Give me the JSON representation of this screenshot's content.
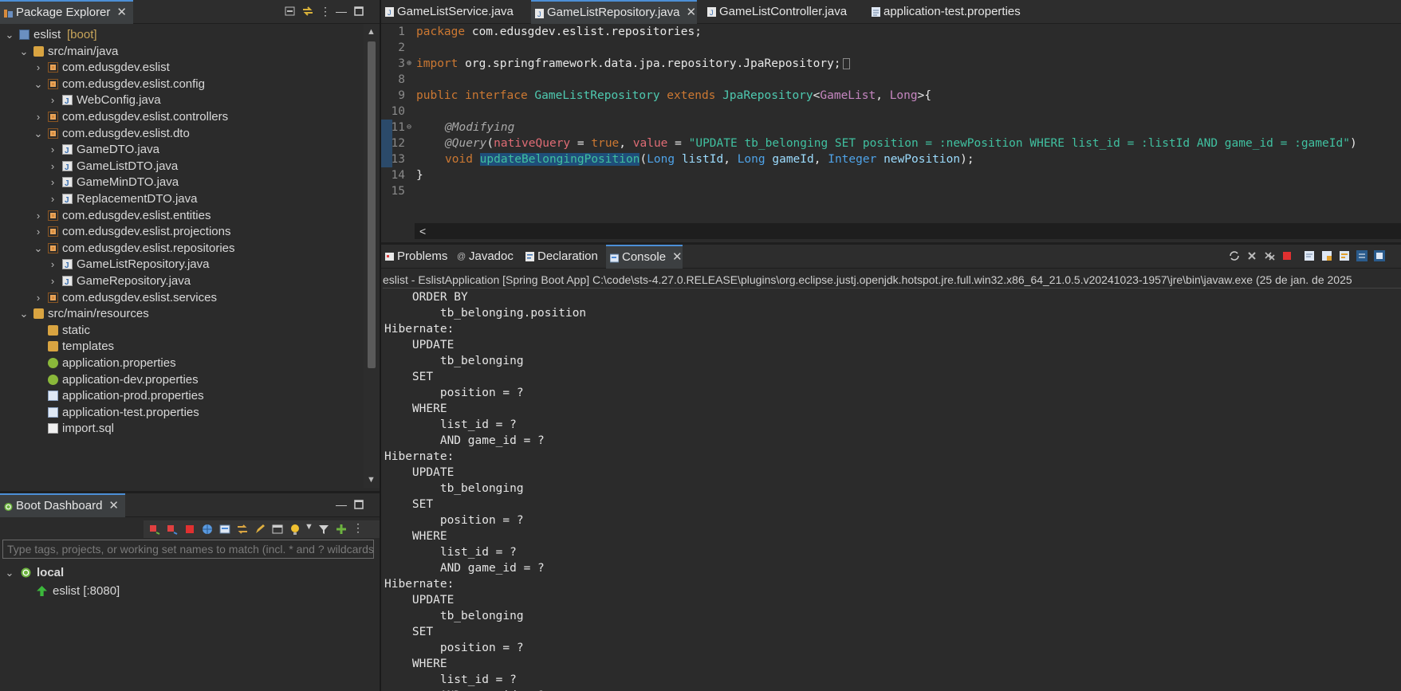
{
  "package_explorer": {
    "title": "Package Explorer",
    "tree": [
      {
        "label": "eslist",
        "decor": " [boot]",
        "icon": "project-icon",
        "level": 0,
        "expanded": true
      },
      {
        "label": "src/main/java",
        "icon": "source-folder-icon",
        "level": 1,
        "expanded": true
      },
      {
        "label": "com.edusgdev.eslist",
        "icon": "package-icon",
        "level": 2,
        "expanded": false
      },
      {
        "label": "com.edusgdev.eslist.config",
        "icon": "package-icon",
        "level": 2,
        "expanded": true
      },
      {
        "label": "WebConfig.java",
        "icon": "java-file-icon",
        "level": 3,
        "expanded": false
      },
      {
        "label": "com.edusgdev.eslist.controllers",
        "icon": "package-icon",
        "level": 2,
        "expanded": false
      },
      {
        "label": "com.edusgdev.eslist.dto",
        "icon": "package-icon",
        "level": 2,
        "expanded": true
      },
      {
        "label": "GameDTO.java",
        "icon": "java-file-icon",
        "level": 3,
        "expanded": false
      },
      {
        "label": "GameListDTO.java",
        "icon": "java-file-icon",
        "level": 3,
        "expanded": false
      },
      {
        "label": "GameMinDTO.java",
        "icon": "java-file-icon",
        "level": 3,
        "expanded": false
      },
      {
        "label": "ReplacementDTO.java",
        "icon": "java-file-icon",
        "level": 3,
        "expanded": false
      },
      {
        "label": "com.edusgdev.eslist.entities",
        "icon": "package-icon",
        "level": 2,
        "expanded": false
      },
      {
        "label": "com.edusgdev.eslist.projections",
        "icon": "package-icon",
        "level": 2,
        "expanded": false
      },
      {
        "label": "com.edusgdev.eslist.repositories",
        "icon": "package-icon",
        "level": 2,
        "expanded": true
      },
      {
        "label": "GameListRepository.java",
        "icon": "java-interface-icon",
        "level": 3,
        "expanded": false
      },
      {
        "label": "GameRepository.java",
        "icon": "java-interface-icon",
        "level": 3,
        "expanded": false
      },
      {
        "label": "com.edusgdev.eslist.services",
        "icon": "package-icon",
        "level": 2,
        "expanded": false
      },
      {
        "label": "src/main/resources",
        "icon": "source-folder-icon",
        "level": 1,
        "expanded": true
      },
      {
        "label": "static",
        "icon": "folder-icon",
        "level": 2,
        "expanded": null
      },
      {
        "label": "templates",
        "icon": "folder-icon",
        "level": 2,
        "expanded": null
      },
      {
        "label": "application.properties",
        "icon": "properties-file-icon",
        "level": 2,
        "expanded": null
      },
      {
        "label": "application-dev.properties",
        "icon": "properties-file-icon",
        "level": 2,
        "expanded": null
      },
      {
        "label": "application-prod.properties",
        "icon": "text-file-icon",
        "level": 2,
        "expanded": null
      },
      {
        "label": "application-test.properties",
        "icon": "text-file-icon",
        "level": 2,
        "expanded": null
      },
      {
        "label": "import.sql",
        "icon": "sql-file-icon",
        "level": 2,
        "expanded": null
      }
    ]
  },
  "boot_dashboard": {
    "title": "Boot Dashboard",
    "filter_placeholder": "Type tags, projects, or working set names to match (incl. * and ? wildcards)",
    "local_label": "local",
    "app_label": "eslist [:8080]"
  },
  "editor": {
    "tabs": [
      {
        "label": "GameListService.java",
        "active": false
      },
      {
        "label": "GameListRepository.java",
        "active": true
      },
      {
        "label": "GameListController.java",
        "active": false
      },
      {
        "label": "application-test.properties",
        "active": false
      }
    ],
    "lines": {
      "n1": "1",
      "n2": "2",
      "n3": "3",
      "n8": "8",
      "n9": "9",
      "n10": "10",
      "n11": "11",
      "n12": "12",
      "n13": "13",
      "n14": "14",
      "n15": "15",
      "l1_kw": "package",
      "l1_rest": " com.edusgdev.eslist.repositories;",
      "l3_kw": "import",
      "l3_rest": " org.springframework.data.jpa.repository.JpaRepository;",
      "l9_kw1": "public",
      "l9_kw2": " interface ",
      "l9_name": "GameListRepository",
      "l9_kw3": " extends ",
      "l9_type": "JpaRepository",
      "l9_lt": "<",
      "l9_g1": "GameList",
      "l9_comma": ", ",
      "l9_g2": "Long",
      "l9_end": ">{",
      "l11": "@Modifying",
      "l12_ann": "@Query",
      "l12_p1": "(",
      "l12_k1": "nativeQuery",
      "l12_eq1": " = ",
      "l12_v1": "true",
      "l12_c": ", ",
      "l12_k2": "value",
      "l12_eq2": " = ",
      "l12_str": "\"UPDATE tb_belonging SET position = :newPosition WHERE list_id = :listId AND game_id = :gameId\"",
      "l12_end": ")",
      "l13_kw": "void",
      "l13_name": "updateBelongingPosition",
      "l13_p": "(",
      "l13_t1": "Long",
      "l13_a1": "listId",
      "l13_c1": ", ",
      "l13_t2": "Long",
      "l13_a2": "gameId",
      "l13_c2": ", ",
      "l13_t3": "Integer",
      "l13_a3": "newPosition",
      "l13_end": ");",
      "l14": "}"
    }
  },
  "console": {
    "tabs": [
      {
        "label": "Problems",
        "active": false
      },
      {
        "label": "Javadoc",
        "active": false
      },
      {
        "label": "Declaration",
        "active": false
      },
      {
        "label": "Console",
        "active": true
      }
    ],
    "path": "eslist - EslistApplication [Spring Boot App] C:\\code\\sts-4.27.0.RELEASE\\plugins\\org.eclipse.justj.openjdk.hotspot.jre.full.win32.x86_64_21.0.5.v20241023-1957\\jre\\bin\\javaw.exe  (25 de jan. de 2025",
    "output": [
      "    ORDER BY",
      "        tb_belonging.position",
      "Hibernate: ",
      "    UPDATE",
      "        tb_belonging ",
      "    SET",
      "        position = ? ",
      "    WHERE",
      "        list_id = ? ",
      "        AND game_id = ?",
      "Hibernate: ",
      "    UPDATE",
      "        tb_belonging ",
      "    SET",
      "        position = ? ",
      "    WHERE",
      "        list_id = ? ",
      "        AND game_id = ?",
      "Hibernate: ",
      "    UPDATE",
      "        tb_belonging ",
      "    SET",
      "        position = ? ",
      "    WHERE",
      "        list_id = ? ",
      "        AND game_id = ?"
    ]
  }
}
